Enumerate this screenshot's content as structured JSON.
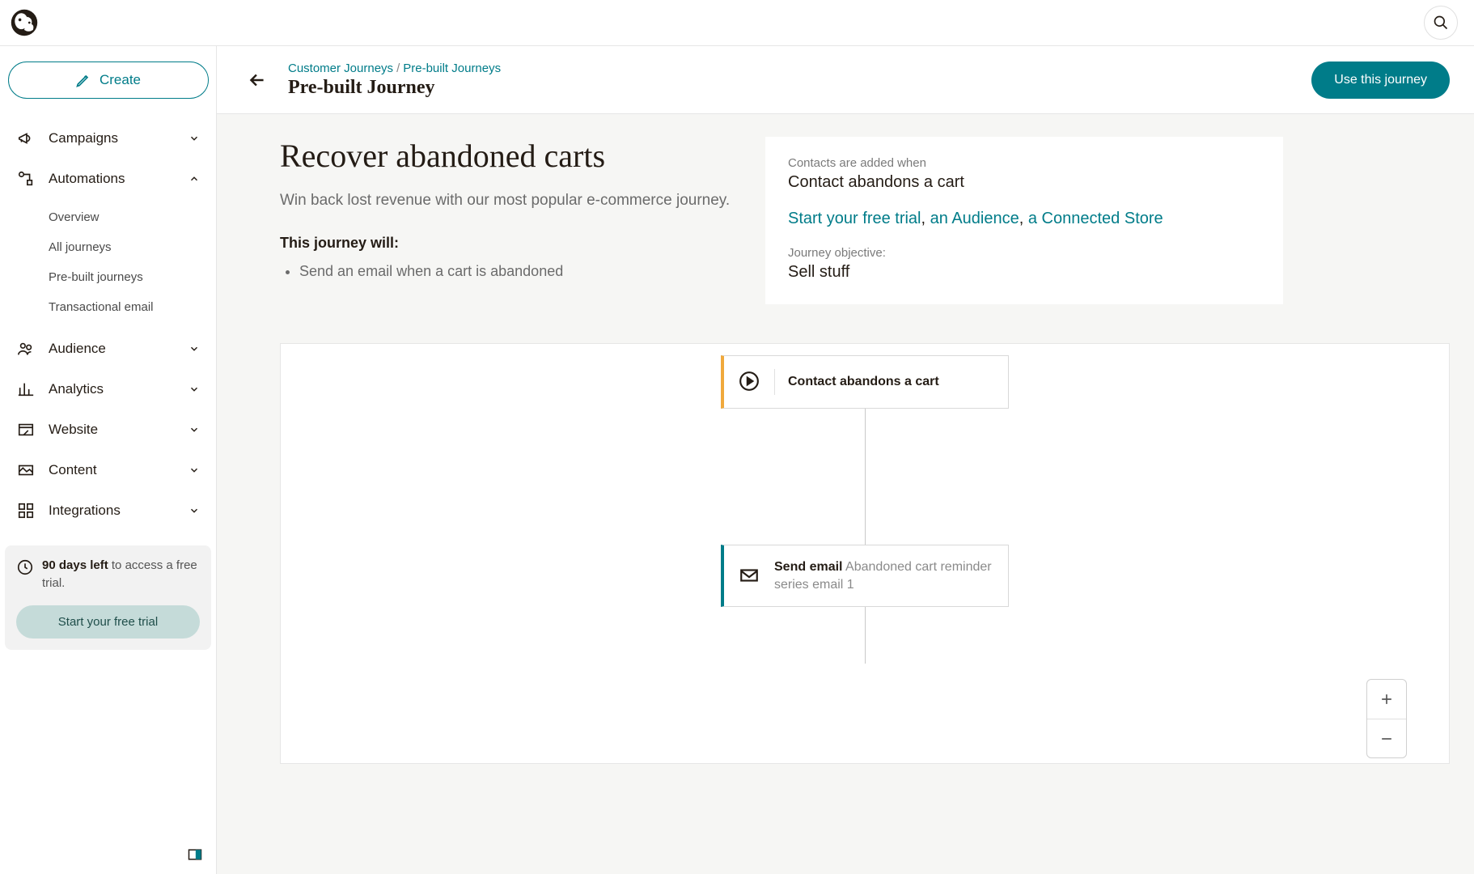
{
  "sidebar": {
    "create_label": "Create",
    "items": [
      {
        "label": "Campaigns",
        "expanded": false
      },
      {
        "label": "Automations",
        "expanded": true,
        "children": [
          {
            "label": "Overview"
          },
          {
            "label": "All journeys"
          },
          {
            "label": "Pre-built journeys"
          },
          {
            "label": "Transactional email"
          }
        ]
      },
      {
        "label": "Audience",
        "expanded": false
      },
      {
        "label": "Analytics",
        "expanded": false
      },
      {
        "label": "Website",
        "expanded": false
      },
      {
        "label": "Content",
        "expanded": false
      },
      {
        "label": "Integrations",
        "expanded": false
      }
    ],
    "trial": {
      "days_left": "90 days left",
      "rest": " to access a free trial.",
      "cta": "Start your free trial"
    }
  },
  "breadcrumb": {
    "a": "Customer Journeys",
    "b": "Pre-built Journeys",
    "title": "Pre-built Journey"
  },
  "cta": {
    "use": "Use this journey"
  },
  "hero": {
    "title": "Recover abandoned carts",
    "subtitle": "Win back lost revenue with our most popular e-commerce journey.",
    "will_heading": "This journey will:",
    "will_items": [
      "Send an email when a cart is abandoned"
    ]
  },
  "info": {
    "added_label": "Contacts are added when",
    "added_value": "Contact abandons a cart",
    "links": {
      "a": "Start your free trial",
      "b": "an Audience",
      "c": "a Connected Store"
    },
    "obj_label": "Journey objective:",
    "obj_value": "Sell stuff"
  },
  "canvas": {
    "start_label": "Contact abandons a cart",
    "action_prefix": "Send email",
    "action_rest": "Abandoned cart reminder series email 1"
  }
}
